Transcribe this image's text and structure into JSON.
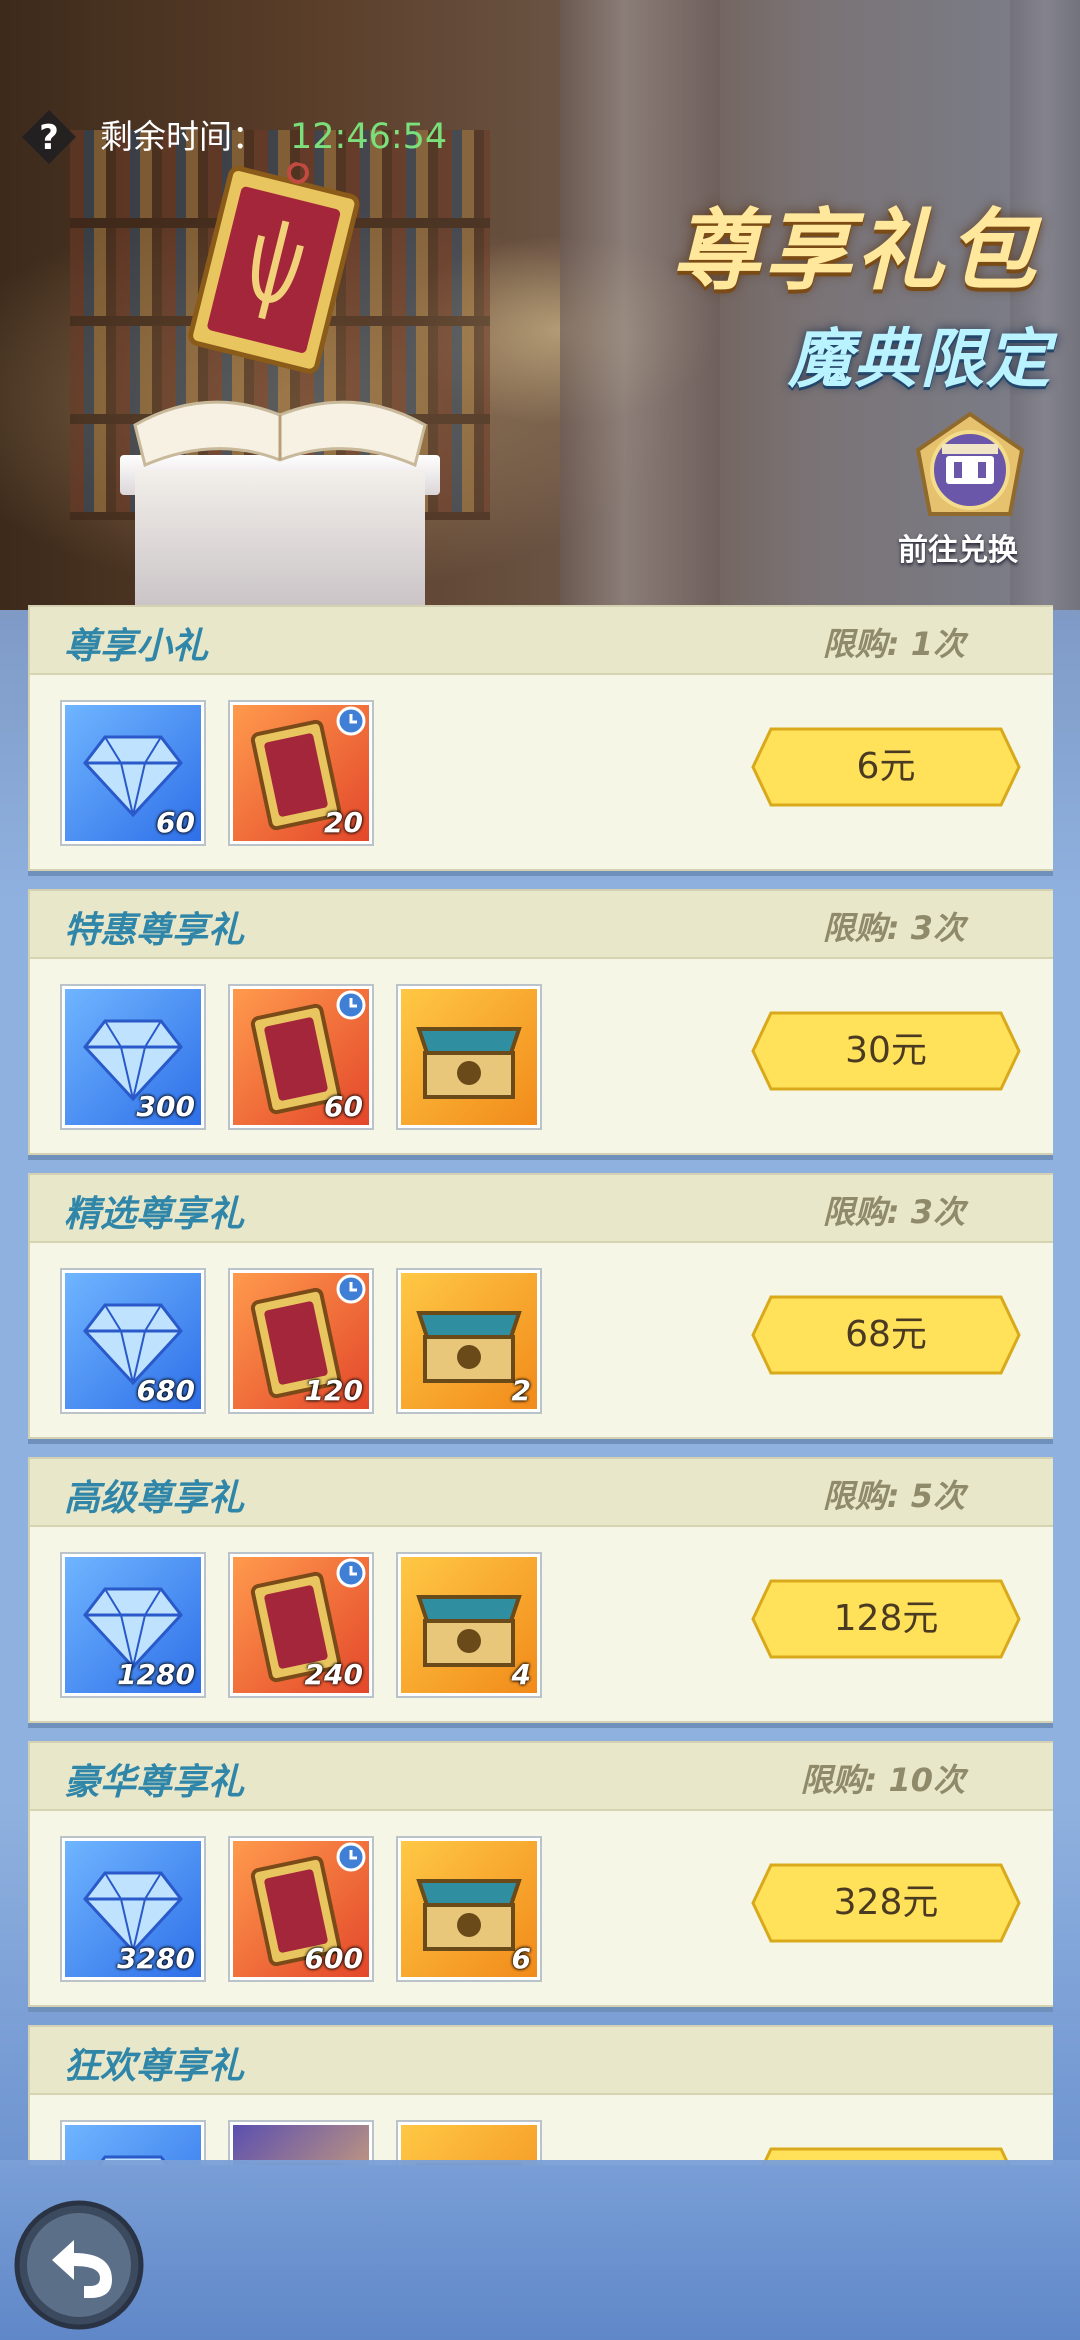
{
  "header": {
    "timer_label": "剩余时间：",
    "timer_value": "12:46:54",
    "title_main": "尊享礼包",
    "title_sub": "魔典限定",
    "exchange_label": "前往兑换",
    "icons": [
      "help-icon",
      "exchange-shop-icon"
    ]
  },
  "packs": [
    {
      "name": "尊享小礼",
      "limit": "限购: 1次",
      "price": "6元",
      "items": [
        {
          "type": "diamond",
          "qty": "60"
        },
        {
          "type": "card",
          "qty": "20"
        }
      ]
    },
    {
      "name": "特惠尊享礼",
      "limit": "限购: 3次",
      "price": "30元",
      "items": [
        {
          "type": "diamond",
          "qty": "300"
        },
        {
          "type": "card",
          "qty": "60"
        },
        {
          "type": "chest",
          "qty": ""
        }
      ]
    },
    {
      "name": "精选尊享礼",
      "limit": "限购: 3次",
      "price": "68元",
      "items": [
        {
          "type": "diamond",
          "qty": "680"
        },
        {
          "type": "card",
          "qty": "120"
        },
        {
          "type": "chest",
          "qty": "2"
        }
      ]
    },
    {
      "name": "高级尊享礼",
      "limit": "限购: 5次",
      "price": "128元",
      "items": [
        {
          "type": "diamond",
          "qty": "1280"
        },
        {
          "type": "card",
          "qty": "240"
        },
        {
          "type": "chest",
          "qty": "4"
        }
      ]
    },
    {
      "name": "豪华尊享礼",
      "limit": "限购: 10次",
      "price": "328元",
      "items": [
        {
          "type": "diamond",
          "qty": "3280"
        },
        {
          "type": "card",
          "qty": "600"
        },
        {
          "type": "chest",
          "qty": "6"
        }
      ]
    },
    {
      "name": "狂欢尊享礼",
      "limit": "",
      "price": "",
      "items": [
        {
          "type": "diamond",
          "qty": ""
        },
        {
          "type": "purple",
          "qty": ""
        },
        {
          "type": "chest",
          "qty": ""
        }
      ]
    }
  ],
  "footer": {
    "back_icon": "back-arrow-icon"
  },
  "colors": {
    "pack_title": "#2f86a8",
    "limit_text": "#8f8a6a",
    "price_button": "#ffe15a",
    "timer": "#7be07b",
    "title_main": "#ffe79b",
    "title_sub": "#b8f3ff"
  }
}
